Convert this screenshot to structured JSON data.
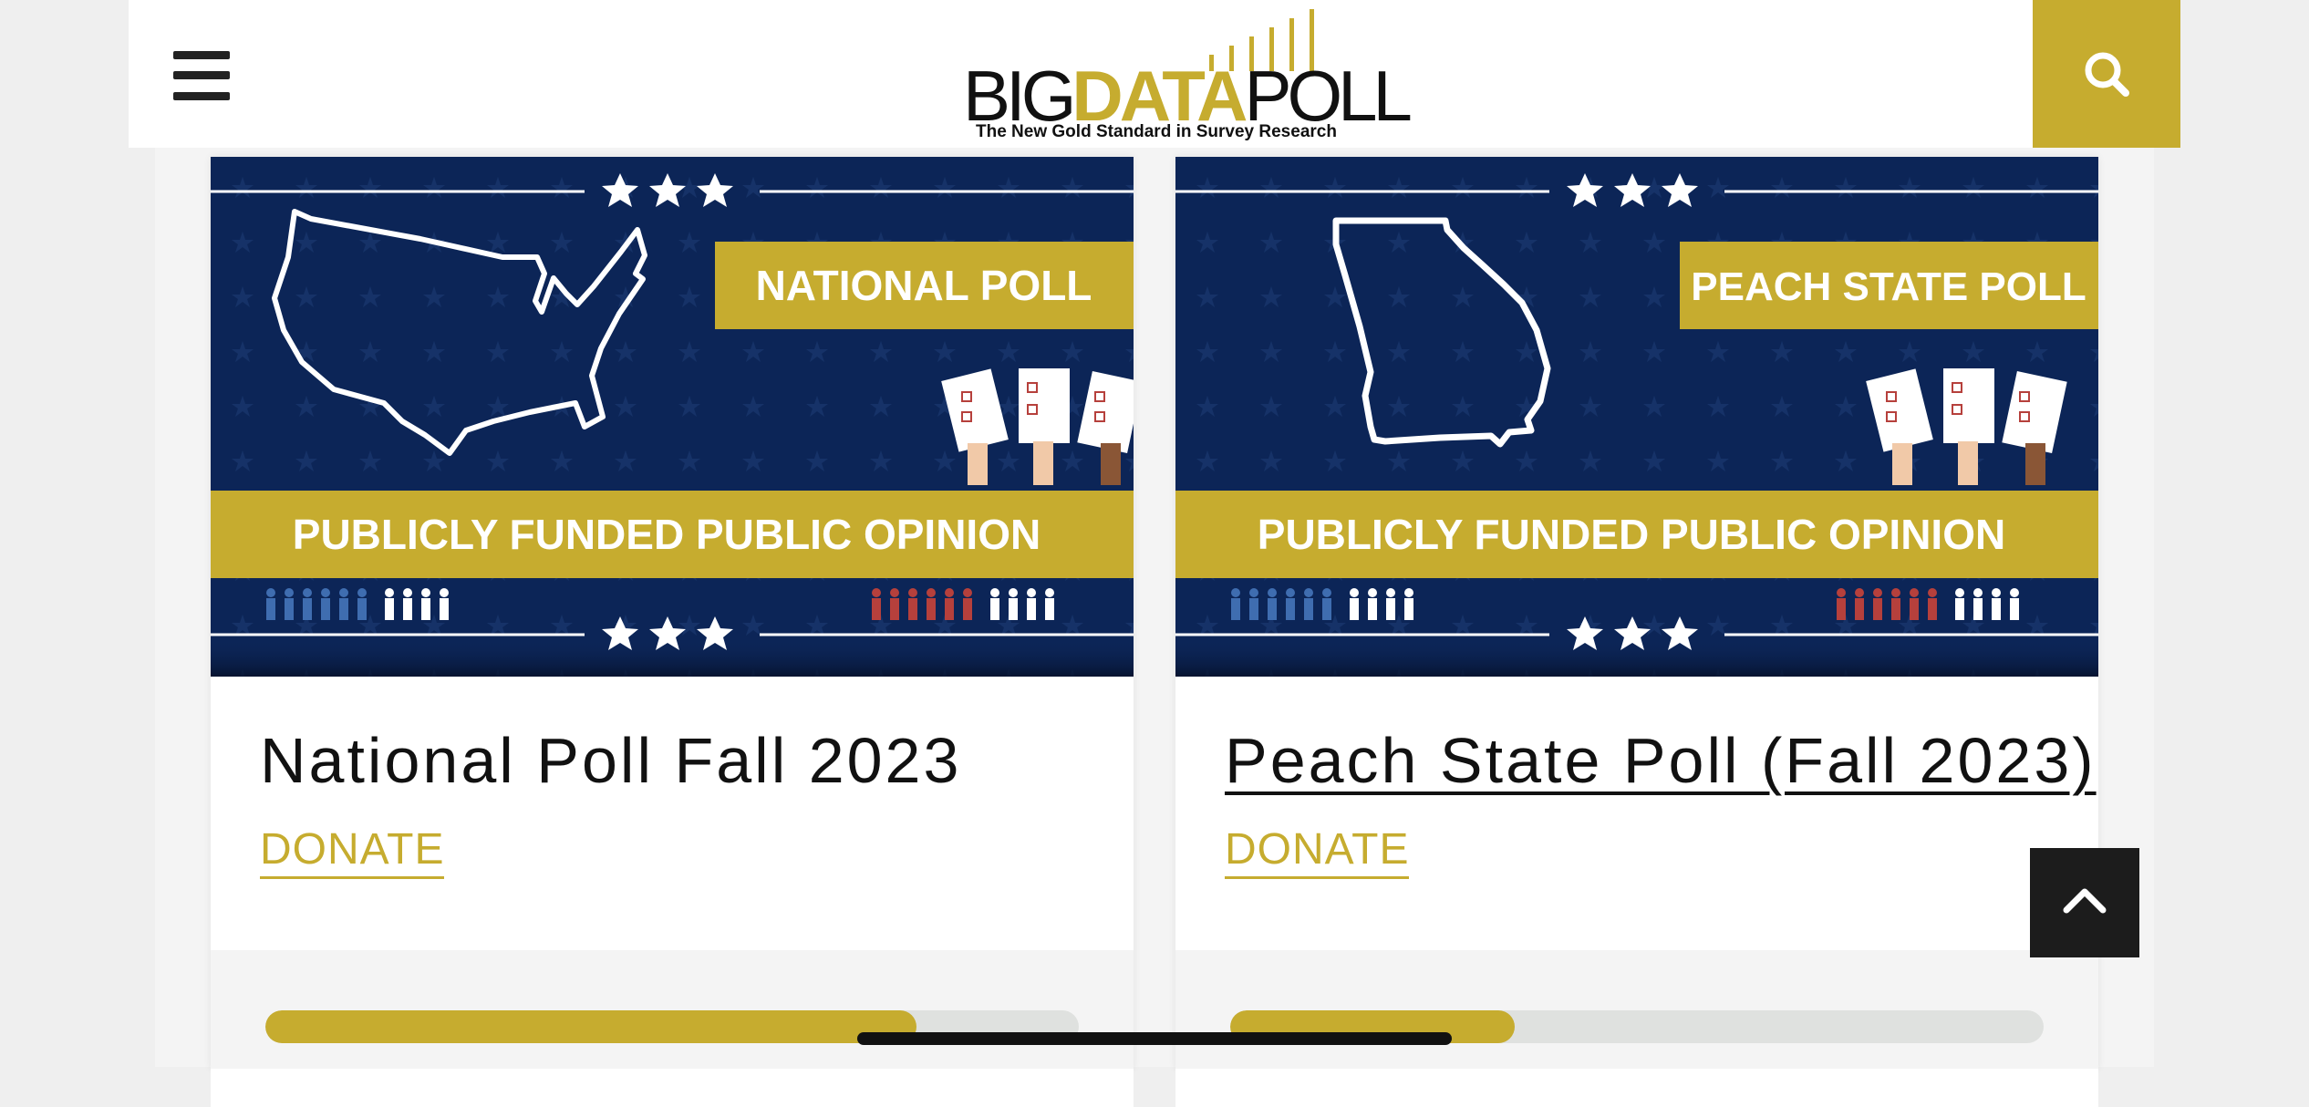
{
  "header": {
    "menu_icon": "hamburger-menu-icon",
    "logo": {
      "big": "BIG",
      "data": "DATA",
      "poll": "POLL",
      "tagline": "The New Gold Standard in Survey Research"
    },
    "search_icon": "magnifier-search-icon"
  },
  "colors": {
    "gold": "#c6ac2f",
    "navy": "#0c2557",
    "dark": "#1c1c1c",
    "red_figure": "#b6403c",
    "blue_figure": "#3f6db0"
  },
  "cards": [
    {
      "banner": {
        "badge": "NATIONAL POLL",
        "strip": "PUBLICLY FUNDED PUBLIC OPINION",
        "map": "usa-outline"
      },
      "title": "National Poll Fall 2023",
      "donate": "DONATE",
      "progress": 0.8
    },
    {
      "banner": {
        "badge": "PEACH STATE POLL",
        "strip": "PUBLICLY FUNDED PUBLIC OPINION",
        "map": "georgia-outline"
      },
      "title": "Peach State Poll (Fall 2023)",
      "donate": "DONATE",
      "progress": 0.35
    }
  ],
  "scroll_top_icon": "chevron-up-icon"
}
